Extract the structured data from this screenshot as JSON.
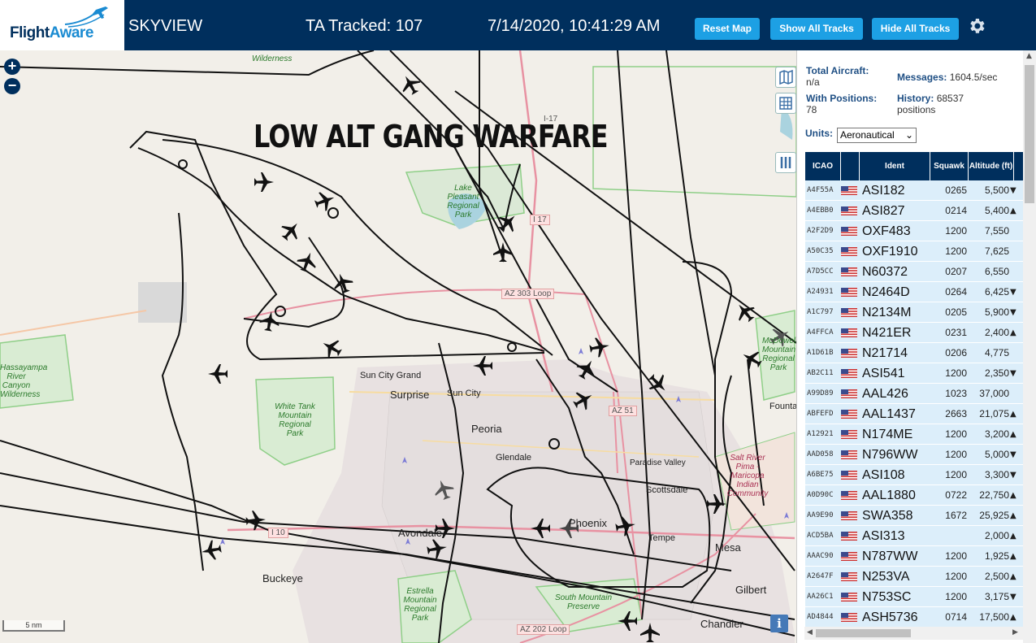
{
  "header": {
    "logo_text_a": "Flight",
    "logo_text_b": "Aware",
    "app_name": "SKYVIEW",
    "tracked": "TA Tracked: 107",
    "datetime": "7/14/2020, 10:41:29 AM",
    "buttons": {
      "reset": "Reset Map",
      "show": "Show All Tracks",
      "hide": "Hide All Tracks"
    },
    "brand_color": "#002f5d",
    "button_color": "#1da0e4"
  },
  "map": {
    "overlay_text": "LOW ALT GANG WARFARE",
    "zoom_in": "+",
    "zoom_out": "−",
    "scale": "5 nm",
    "info": "i",
    "places": [
      "Sun City Grand",
      "Surprise",
      "Sun City",
      "Peoria",
      "Glendale",
      "Paradise Valley",
      "Scottsdale",
      "Phoenix",
      "Tempe",
      "Mesa",
      "Avondale",
      "Buckeye",
      "Gilbert",
      "Chandler",
      "Founta"
    ],
    "parks": [
      "Wilderness",
      "Lake Pleasant Regional Park",
      "White Tank Mountain Regional Park",
      "Estrella Mountain Regional Park",
      "South Mountain Preserve",
      "Salt River Pima - Maricopa Indian Community",
      "McDowell Mountain Regional Park",
      "Hassayampa River Canyon Wilderness"
    ],
    "roads": [
      "I 17",
      "I-17",
      "AZ 303 Loop",
      "AZ 51",
      "I 10",
      "AZ 202 Loop"
    ]
  },
  "panel": {
    "total_label": "Total Aircraft:",
    "total_value": "n/a",
    "messages_label": "Messages:",
    "messages_value": "1604.5/sec",
    "positions_label": "With Positions:",
    "positions_value": "78",
    "history_label": "History:",
    "history_value": "68537",
    "history_unit": "positions",
    "units_label": "Units:",
    "units_value": "Aeronautical",
    "columns": [
      "ICAO",
      "Ident",
      "Squawk",
      "Altitude (ft)"
    ],
    "rows": [
      {
        "icao": "A4F55A",
        "ident": "ASI182",
        "squawk": "0265",
        "alt": "5,500",
        "trend": "▼"
      },
      {
        "icao": "A4EBB0",
        "ident": "ASI827",
        "squawk": "0214",
        "alt": "5,400",
        "trend": "▲"
      },
      {
        "icao": "A2F2D9",
        "ident": "OXF483",
        "squawk": "1200",
        "alt": "7,550",
        "trend": ""
      },
      {
        "icao": "A50C35",
        "ident": "OXF1910",
        "squawk": "1200",
        "alt": "7,625",
        "trend": ""
      },
      {
        "icao": "A7D5CC",
        "ident": "N60372",
        "squawk": "0207",
        "alt": "6,550",
        "trend": ""
      },
      {
        "icao": "A24931",
        "ident": "N2464D",
        "squawk": "0264",
        "alt": "6,425",
        "trend": "▼"
      },
      {
        "icao": "A1C797",
        "ident": "N2134M",
        "squawk": "0205",
        "alt": "5,900",
        "trend": "▼"
      },
      {
        "icao": "A4FFCA",
        "ident": "N421ER",
        "squawk": "0231",
        "alt": "2,400",
        "trend": "▲"
      },
      {
        "icao": "A1D61B",
        "ident": "N21714",
        "squawk": "0206",
        "alt": "4,775",
        "trend": ""
      },
      {
        "icao": "AB2C11",
        "ident": "ASI541",
        "squawk": "1200",
        "alt": "2,350",
        "trend": "▼"
      },
      {
        "icao": "A99D89",
        "ident": "AAL426",
        "squawk": "1023",
        "alt": "37,000",
        "trend": ""
      },
      {
        "icao": "ABFEFD",
        "ident": "AAL1437",
        "squawk": "2663",
        "alt": "21,075",
        "trend": "▲"
      },
      {
        "icao": "A12921",
        "ident": "N174ME",
        "squawk": "1200",
        "alt": "3,200",
        "trend": "▲"
      },
      {
        "icao": "AAD058",
        "ident": "N796WW",
        "squawk": "1200",
        "alt": "5,000",
        "trend": "▼"
      },
      {
        "icao": "A6BE75",
        "ident": "ASI108",
        "squawk": "1200",
        "alt": "3,300",
        "trend": "▼"
      },
      {
        "icao": "A0D90C",
        "ident": "AAL1880",
        "squawk": "0722",
        "alt": "22,750",
        "trend": "▲"
      },
      {
        "icao": "AA9E90",
        "ident": "SWA358",
        "squawk": "1672",
        "alt": "25,925",
        "trend": "▲"
      },
      {
        "icao": "ACD5BA",
        "ident": "ASI313",
        "squawk": "",
        "alt": "2,000",
        "trend": "▲"
      },
      {
        "icao": "AAAC90",
        "ident": "N787WW",
        "squawk": "1200",
        "alt": "1,925",
        "trend": "▲"
      },
      {
        "icao": "A2647F",
        "ident": "N253VA",
        "squawk": "1200",
        "alt": "2,500",
        "trend": "▲"
      },
      {
        "icao": "AA26C1",
        "ident": "N753SC",
        "squawk": "1200",
        "alt": "3,175",
        "trend": "▼"
      },
      {
        "icao": "AD4844",
        "ident": "ASH5736",
        "squawk": "0714",
        "alt": "17,500",
        "trend": "▲"
      }
    ]
  }
}
